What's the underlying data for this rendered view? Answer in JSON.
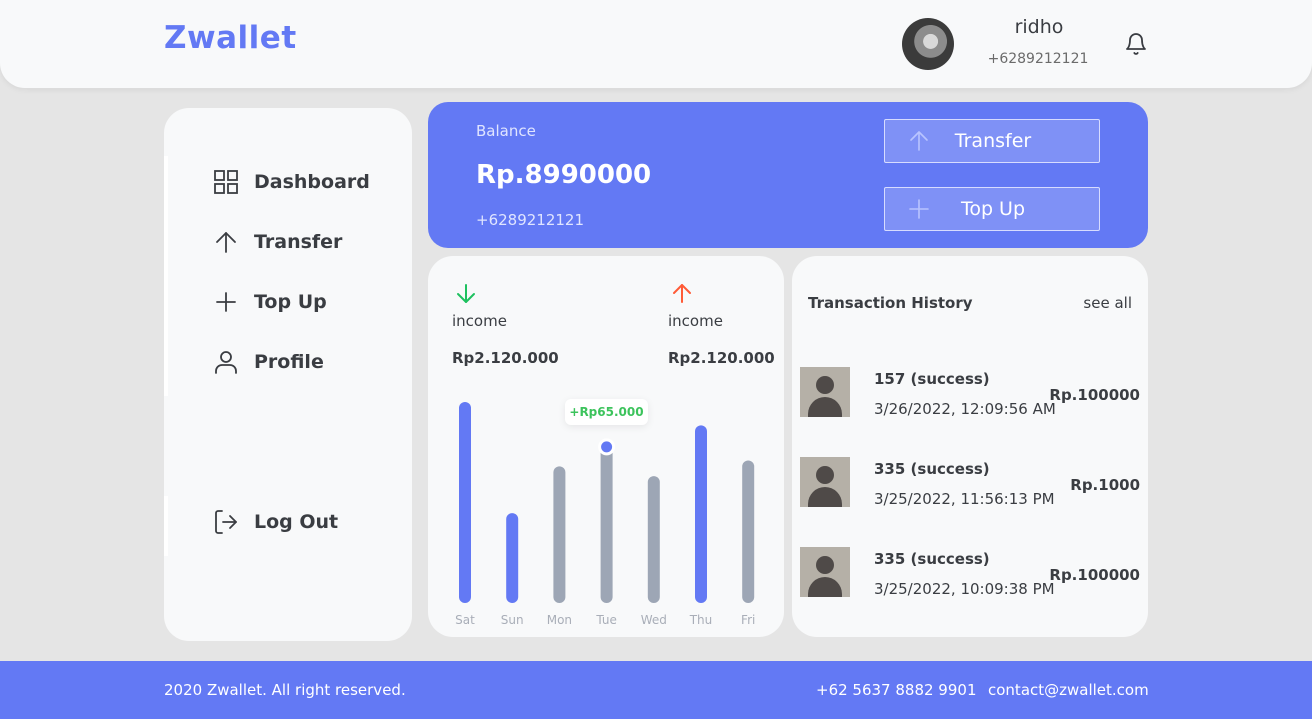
{
  "header": {
    "logo": "Zwallet",
    "user_name": "ridho",
    "user_phone": "+6289212121",
    "avatar_icon": "user-avatar",
    "notification_icon": "bell-icon"
  },
  "sidebar": {
    "items": [
      {
        "label": "Dashboard",
        "icon": "grid-icon"
      },
      {
        "label": "Transfer",
        "icon": "arrow-up-icon"
      },
      {
        "label": "Top Up",
        "icon": "plus-icon"
      },
      {
        "label": "Profile",
        "icon": "user-icon"
      }
    ],
    "logout": {
      "label": "Log Out",
      "icon": "logout-icon"
    }
  },
  "balance": {
    "label": "Balance",
    "amount": "Rp.8990000",
    "phone": "+6289212121",
    "transfer_label": "Transfer",
    "topup_label": "Top Up"
  },
  "stats": {
    "income": {
      "label": "income",
      "value": "Rp2.120.000",
      "icon": "arrow-down-icon",
      "color": "#1ec15f"
    },
    "expense": {
      "label": "income",
      "value": "Rp2.120.000",
      "icon": "arrow-up-icon",
      "color": "#ff5b37"
    }
  },
  "chart_data": {
    "type": "bar",
    "categories": [
      "Sat",
      "Sun",
      "Mon",
      "Tue",
      "Wed",
      "Thu",
      "Fri"
    ],
    "values": [
      100,
      43,
      67,
      77,
      62,
      88,
      70
    ],
    "highlighted": [
      true,
      true,
      false,
      false,
      false,
      true,
      false
    ],
    "tooltip": {
      "category": "Tue",
      "label": "+Rp65.000"
    },
    "colors": {
      "highlight": "#6379f4",
      "normal": "#9da6b5",
      "tooltip_text": "#3cc35c"
    }
  },
  "history": {
    "title": "Transaction History",
    "see_all": "see all",
    "transactions": [
      {
        "name": "157 (success)",
        "date": "3/26/2022, 12:09:56 AM",
        "amount": "Rp.100000"
      },
      {
        "name": "335 (success)",
        "date": "3/25/2022, 11:56:13 PM",
        "amount": "Rp.1000"
      },
      {
        "name": "335 (success)",
        "date": "3/25/2022, 10:09:38 PM",
        "amount": "Rp.100000"
      }
    ]
  },
  "footer": {
    "copyright": "2020 Zwallet. All right reserved.",
    "phone": "+62 5637 8882 9901",
    "email": "contact@zwallet.com"
  },
  "colors": {
    "primary": "#6379f4",
    "background": "#e5e5e5",
    "card": "#f8f9fa",
    "text": "#3a3d42"
  }
}
